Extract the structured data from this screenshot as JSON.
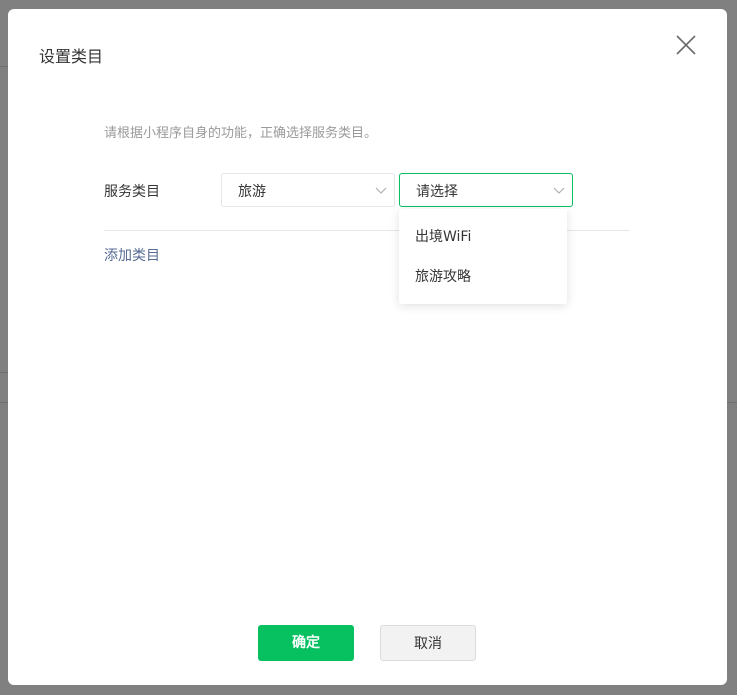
{
  "dialog": {
    "title": "设置类目",
    "hint": "请根据小程序自身的功能，正确选择服务类目。",
    "field_label": "服务类目",
    "primary_select": {
      "value": "旅游"
    },
    "secondary_select": {
      "value": "请选择",
      "options": [
        "出境WiFi",
        "旅游攻略"
      ]
    },
    "add_link": "添加类目",
    "confirm_label": "确定",
    "cancel_label": "取消"
  },
  "icons": {
    "close": "close-icon",
    "chevron": "chevron-down-icon"
  },
  "colors": {
    "primary": "#07c160",
    "link": "#576b95",
    "overlay": "#808080"
  }
}
